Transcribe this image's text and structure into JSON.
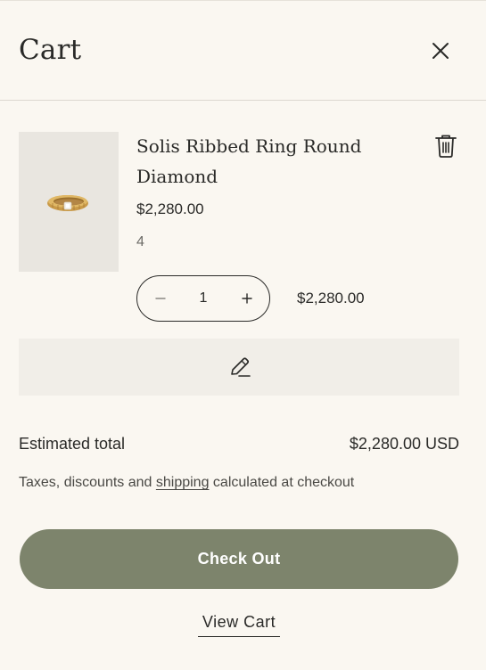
{
  "header": {
    "title": "Cart",
    "close_icon": "close-icon"
  },
  "item": {
    "name": "Solis Ribbed Ring Round Diamond",
    "price": "$2,280.00",
    "option": "4",
    "quantity": "1",
    "line_total": "$2,280.00",
    "image_icon": "ring-image",
    "delete_icon": "trash-icon",
    "minus_icon": "minus-icon",
    "plus_icon": "plus-icon",
    "edit_icon": "pencil-icon"
  },
  "summary": {
    "estimated_label": "Estimated total",
    "estimated_value": "$2,280.00 USD",
    "tax_prefix": "Taxes, discounts and ",
    "shipping_link": "shipping",
    "tax_suffix": " calculated at checkout"
  },
  "actions": {
    "checkout_label": "Check Out",
    "view_cart_label": "View Cart"
  },
  "colors": {
    "background": "#faf7f1",
    "checkout_button": "#7d846c",
    "edit_bar": "#f1eee8",
    "image_bg": "#e9e6e0",
    "text": "#2a2a28"
  }
}
